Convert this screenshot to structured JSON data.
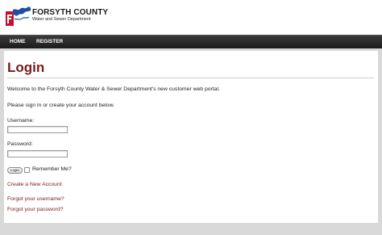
{
  "header": {
    "org_name": "FORSYTH COUNTY",
    "org_subtitle": "Water and Sewer Department"
  },
  "nav": {
    "items": [
      "HOME",
      "REGISTER"
    ]
  },
  "main": {
    "title": "Login",
    "welcome": "Welcome to the Forsyth County Water & Sewer Department's new customer web portal.",
    "instructions": "Please sign in or create your account below.",
    "username_label": "Username:",
    "password_label": "Password:",
    "login_button": "Login",
    "remember_label": "Remember Me?",
    "create_account": "Create a New Account",
    "forgot_username": "Forgot your username?",
    "forgot_password": "Forgot your password?"
  },
  "colors": {
    "accent": "#7a1a1a",
    "logo_red": "#c8102e",
    "logo_blue": "#1e4fa0"
  }
}
